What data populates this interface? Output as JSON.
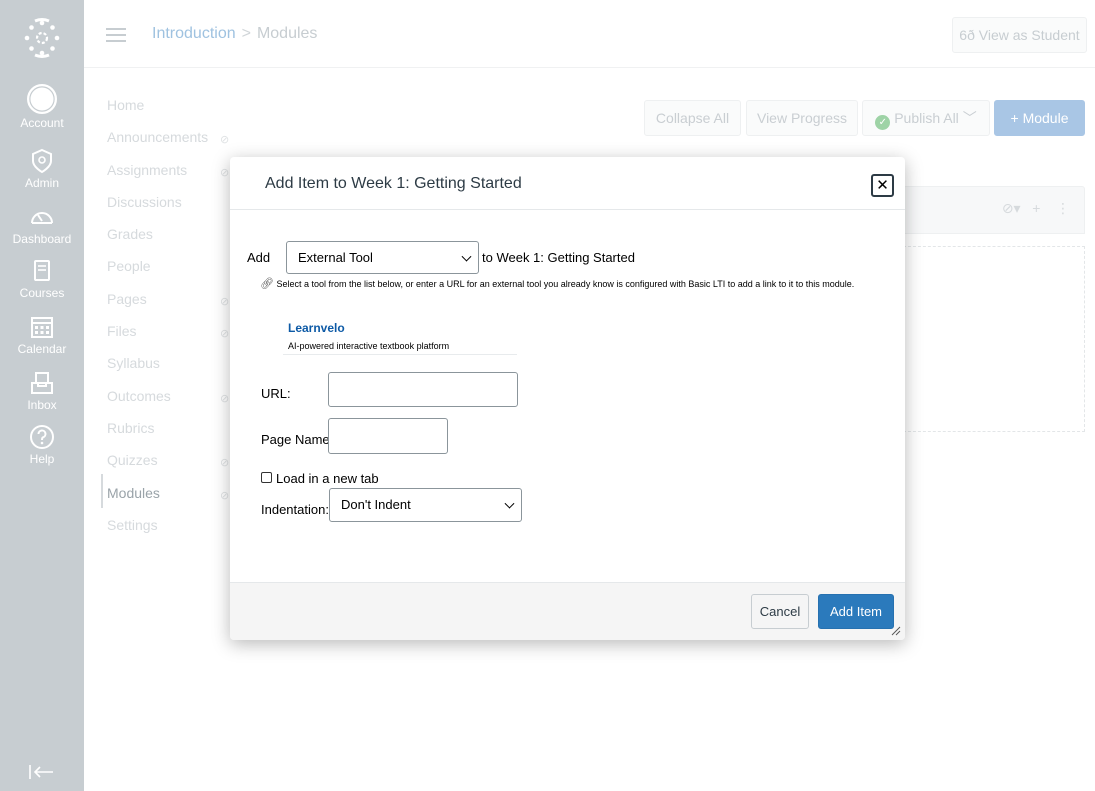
{
  "global_nav": {
    "items": [
      {
        "label": "Account",
        "icon": "account-icon"
      },
      {
        "label": "Admin",
        "icon": "admin-shield-icon"
      },
      {
        "label": "Dashboard",
        "icon": "dashboard-gauge-icon"
      },
      {
        "label": "Courses",
        "icon": "courses-book-icon"
      },
      {
        "label": "Calendar",
        "icon": "calendar-icon"
      },
      {
        "label": "Inbox",
        "icon": "inbox-icon"
      },
      {
        "label": "Help",
        "icon": "help-icon"
      }
    ],
    "collapse_glyph": "|←"
  },
  "header": {
    "breadcrumb": [
      "Introduction",
      "Modules"
    ],
    "breadcrumb_sep": ">",
    "view_as_student": "6ð View as Student"
  },
  "course_nav": {
    "items": [
      "Home",
      "Announcements",
      "Assignments",
      "Discussions",
      "Grades",
      "People",
      "Pages",
      "Files",
      "Syllabus",
      "Outcomes",
      "Rubrics",
      "Quizzes",
      "Modules",
      "Settings"
    ],
    "active": "Modules"
  },
  "toolbar": {
    "collapse_all": "Collapse All",
    "view_progress": "View Progress",
    "publish_all": "Publish All",
    "add_module": "+ Module"
  },
  "modal": {
    "title": "Add Item to Week 1: Getting Started",
    "close": "✕",
    "add_label": "Add",
    "item_type": "External Tool",
    "to_label": "to Week 1: Getting Started",
    "help_text": "Select a tool from the list below, or enter a URL for an external tool you already know is configured with Basic LTI to add a link to it to this module.",
    "tool": {
      "name": "Learnvelo",
      "description": "AI-powered interactive textbook platform"
    },
    "url_label": "URL:",
    "page_name_label": "Page Name:",
    "new_tab_label": "Load in a new tab",
    "indentation_label": "Indentation:",
    "indentation_value": "Don't Indent",
    "cancel": "Cancel",
    "submit": "Add Item"
  },
  "colors": {
    "nav_bg": "#c7cdd1",
    "primary": "#2b7abc",
    "link": "#0d5aa6"
  }
}
